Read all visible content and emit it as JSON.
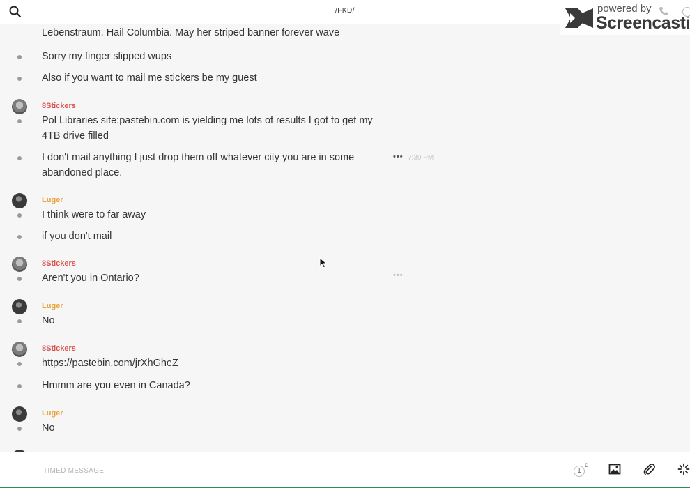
{
  "header": {
    "channel_title": "/FKD/",
    "search_icon": "search-icon"
  },
  "watermark": {
    "powered": "powered by",
    "brand": "Screencastify"
  },
  "messages": [
    {
      "id": "m1",
      "text": "Lebenstraum. Hail Columbia. May her striped banner forever wave"
    },
    {
      "id": "m2",
      "text": "Sorry my finger slipped wups"
    },
    {
      "id": "m3",
      "text": "Also if you want to mail me stickers be my guest"
    },
    {
      "id": "m4",
      "author": "8Stickers",
      "text": "Pol Libraries site:pastebin.com is yielding me lots of results I got to get my 4TB drive filled"
    },
    {
      "id": "m5",
      "text": "I don't mail anything I just drop them off whatever city you are in some abandoned place.",
      "time": "7:39 PM"
    },
    {
      "id": "m6",
      "author": "Luger",
      "text": "I think were to far away"
    },
    {
      "id": "m7",
      "text": "if you don't mail"
    },
    {
      "id": "m8",
      "author": "8Stickers",
      "text": "Aren't you in Ontario?"
    },
    {
      "id": "m9",
      "author": "Luger",
      "text": "No"
    },
    {
      "id": "m10",
      "author": "8Stickers",
      "text": "https://pastebin.com/jrXhGheZ"
    },
    {
      "id": "m11",
      "text": "Hmmm are you even in Canada?"
    },
    {
      "id": "m12",
      "author": "Luger",
      "text": "No"
    }
  ],
  "colors": {
    "author_8stickers": "#d9534f",
    "author_luger": "#e8a33d",
    "link": "#2a9fd6"
  },
  "composer": {
    "placeholder": "TIMED MESSAGE",
    "timer_value": "1",
    "timer_unit": "d"
  }
}
